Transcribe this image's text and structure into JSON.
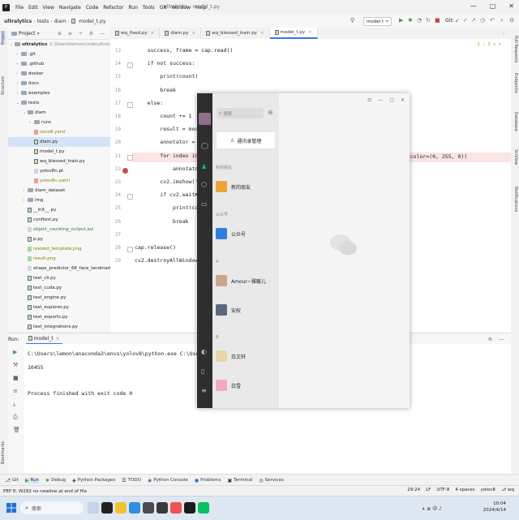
{
  "menubar": {
    "items": [
      "File",
      "Edit",
      "View",
      "Navigate",
      "Code",
      "Refactor",
      "Run",
      "Tools",
      "Git",
      "Window",
      "Help"
    ],
    "window_title": "ultralytics - model_t.py",
    "window_buttons": [
      "—",
      "▢",
      "✕"
    ]
  },
  "navbar": {
    "breadcrumbs": [
      "ultralytics",
      "tests",
      "diam",
      "model_t.py"
    ],
    "run_config": "model t",
    "git_label": "Git:"
  },
  "left_strip": {
    "labels": [
      "Project",
      "Structure",
      "Bookmarks"
    ]
  },
  "right_strip": {
    "labels": [
      "Pull Requests",
      "Endpoints",
      "Database",
      "SciView",
      "Notifications"
    ]
  },
  "project": {
    "title": "Project",
    "items": [
      {
        "label": "ultralytics",
        "extra": "C:\\Users\\lemon\\code\\ultralytics",
        "type": "root",
        "indent": 0,
        "open": true
      },
      {
        "label": ".git",
        "type": "folder",
        "indent": 1,
        "open": false
      },
      {
        "label": ".github",
        "type": "folder",
        "indent": 1,
        "open": false
      },
      {
        "label": "docker",
        "type": "folder",
        "indent": 1,
        "open": false
      },
      {
        "label": "docs",
        "type": "folder",
        "indent": 1,
        "open": false
      },
      {
        "label": "examples",
        "type": "folder",
        "indent": 1,
        "open": false
      },
      {
        "label": "tests",
        "type": "folder",
        "indent": 1,
        "open": true
      },
      {
        "label": "diam",
        "type": "folder",
        "indent": 2,
        "open": true
      },
      {
        "label": "runs",
        "type": "folder",
        "indent": 3,
        "open": false
      },
      {
        "label": "coco8.yaml",
        "type": "yaml",
        "indent": 3
      },
      {
        "label": "diam.py",
        "type": "py",
        "indent": 3,
        "selected": true
      },
      {
        "label": "model_t.py",
        "type": "py",
        "indent": 3
      },
      {
        "label": "wq_blessed_train.py",
        "type": "py",
        "indent": 3
      },
      {
        "label": "yolov8n.pt",
        "type": "data",
        "indent": 3
      },
      {
        "label": "yolov8n.yaml",
        "type": "yaml",
        "indent": 3
      },
      {
        "label": "diam_dataset",
        "type": "folder",
        "indent": 2,
        "open": false
      },
      {
        "label": "img",
        "type": "folder",
        "indent": 2,
        "open": false
      },
      {
        "label": "__init__.py",
        "type": "py",
        "indent": 2
      },
      {
        "label": "conftest.py",
        "type": "py",
        "indent": 2
      },
      {
        "label": "object_counting_output.avi",
        "type": "data",
        "indent": 2,
        "green": true
      },
      {
        "label": "p.py",
        "type": "py",
        "indent": 2
      },
      {
        "label": "resized_template.png",
        "type": "img",
        "indent": 2
      },
      {
        "label": "result.png",
        "type": "img",
        "indent": 2
      },
      {
        "label": "shape_predictor_68_face_landmarks.dat",
        "type": "data",
        "indent": 2
      },
      {
        "label": "test_cli.py",
        "type": "py",
        "indent": 2
      },
      {
        "label": "test_cuda.py",
        "type": "py",
        "indent": 2
      },
      {
        "label": "test_engine.py",
        "type": "py",
        "indent": 2
      },
      {
        "label": "test_explorer.py",
        "type": "py",
        "indent": 2
      },
      {
        "label": "test_exports.py",
        "type": "py",
        "indent": 2
      },
      {
        "label": "test_integrations.py",
        "type": "py",
        "indent": 2
      }
    ]
  },
  "tabs": [
    {
      "label": "wq_fixed.py",
      "active": false
    },
    {
      "label": "diam.py",
      "active": false
    },
    {
      "label": "wq_blessed_train.py",
      "active": false
    },
    {
      "label": "model_t.py",
      "active": true
    }
  ],
  "editor": {
    "inspection": "3 ⚠ 5 ∧ ∨",
    "lines": [
      {
        "n": "13",
        "text": "    success, frame = cap.read()"
      },
      {
        "n": "14",
        "text": "    if not success:"
      },
      {
        "n": "15",
        "text": "        print(count)"
      },
      {
        "n": "16",
        "text": "        break"
      },
      {
        "n": "17",
        "text": "    else:"
      },
      {
        "n": "18",
        "text": "        count += 1"
      },
      {
        "n": "19",
        "text": "        result = model("
      },
      {
        "n": "20",
        "text": "        annotator = A"
      },
      {
        "n": "21",
        "text": "        for index in r"
      },
      {
        "n": "22",
        "text": "            annotator"
      },
      {
        "n": "23",
        "text": "        cv2.imshow('w"
      },
      {
        "n": "24",
        "text": "        if cv2.waitKey"
      },
      {
        "n": "25",
        "text": "            print(coun"
      },
      {
        "n": "26",
        "text": "            break"
      },
      {
        "n": "27",
        "text": ""
      },
      {
        "n": "28",
        "text": "cap.release()"
      },
      {
        "n": "29",
        "text": "cv2.destroyAllWindows()"
      }
    ],
    "overflow_text": "\"],color=(0, 255, 0))"
  },
  "run": {
    "label": "Run:",
    "tab": "model_t",
    "output": [
      "C:\\Users\\lemon\\anaconda3\\envs\\yolov8\\python.exe C:\\Users\\lemon\\code",
      "10455",
      "",
      "Process finished with exit code 0"
    ]
  },
  "bottom_tools": [
    "Git",
    "Run",
    "Debug",
    "Python Packages",
    "TODO",
    "Python Console",
    "Problems",
    "Terminal",
    "Services"
  ],
  "status": {
    "left": "PEP 8: W292 no newline at end of file",
    "position": "29:24",
    "line_sep": "LF",
    "encoding": "UTF-8",
    "indent": "4 spaces",
    "interpreter": "yolov8",
    "branch": "wq"
  },
  "wechat": {
    "search_placeholder": "搜索",
    "manage_button": "通讯录管理",
    "sections": {
      "new_friends_header": "新的朋友",
      "public_header": "公众号",
      "a_header": "A",
      "b_header": "B"
    },
    "contacts": [
      {
        "name": "新的朋友",
        "color": "#f0a23b"
      },
      {
        "name": "公众号",
        "color": "#2f7fe0"
      },
      {
        "name": "Amour~雅暖儿",
        "color": "#c9a58b"
      },
      {
        "name": "安权",
        "color": "#5a6a7a"
      },
      {
        "name": "白文轩",
        "color": "#e8d7a8"
      },
      {
        "name": "白雪",
        "color": "#f3a9c0"
      }
    ],
    "titlebar_icons": [
      "⊡",
      "—",
      "▢",
      "✕"
    ]
  },
  "taskbar": {
    "search_placeholder": "搜索",
    "time": "10:04",
    "date": "2024/4/14",
    "tray": "∧  ⊕  中  ♪"
  }
}
